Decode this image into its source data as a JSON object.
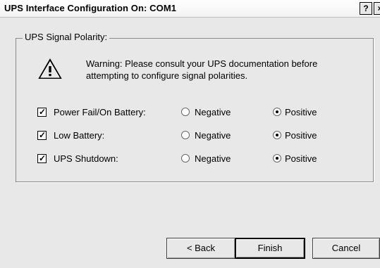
{
  "window": {
    "title": "UPS Interface Configuration On: COM1",
    "help_label": "?",
    "close_label": "×"
  },
  "group": {
    "legend": "UPS Signal Polarity:",
    "warning_line1": "Warning: Please consult your UPS documentation before",
    "warning_line2": "attempting to configure signal polarities.",
    "icon": "warning-icon"
  },
  "rows": [
    {
      "label": "Power Fail/On Battery:",
      "checked": true,
      "negative_label": "Negative",
      "positive_label": "Positive",
      "selected": "positive"
    },
    {
      "label": "Low Battery:",
      "checked": true,
      "negative_label": "Negative",
      "positive_label": "Positive",
      "selected": "positive"
    },
    {
      "label": "UPS Shutdown:",
      "checked": true,
      "negative_label": "Negative",
      "positive_label": "Positive",
      "selected": "positive"
    }
  ],
  "buttons": {
    "back": "< Back",
    "finish": "Finish",
    "cancel": "Cancel"
  }
}
